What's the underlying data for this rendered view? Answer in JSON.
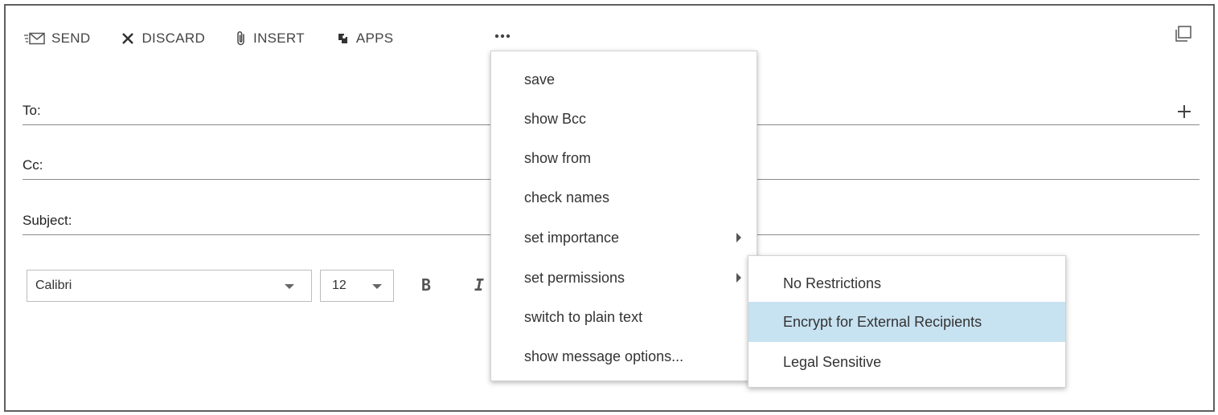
{
  "toolbar": {
    "send_label": "SEND",
    "discard_label": "DISCARD",
    "insert_label": "INSERT",
    "apps_label": "APPS",
    "more_label": "•••"
  },
  "fields": {
    "to_label": "To:",
    "cc_label": "Cc:",
    "subject_label": "Subject:",
    "to_value": "",
    "cc_value": "",
    "subject_value": ""
  },
  "formatting": {
    "font_name": "Calibri",
    "font_size": "12",
    "bold_label": "B",
    "italic_label": "I"
  },
  "menu": {
    "items": [
      {
        "label": "save"
      },
      {
        "label": "show Bcc"
      },
      {
        "label": "show from"
      },
      {
        "label": "check names"
      },
      {
        "label": "set importance"
      },
      {
        "label": "set permissions"
      },
      {
        "label": "switch to plain text"
      },
      {
        "label": "show message options..."
      }
    ]
  },
  "permissions_submenu": {
    "items": [
      {
        "label": "No Restrictions"
      },
      {
        "label": "Encrypt for External Recipients"
      },
      {
        "label": "Legal Sensitive"
      }
    ]
  },
  "colors": {
    "highlight": "#c7e2f1",
    "text": "#333333",
    "border": "#5f5f5f"
  },
  "icons": {
    "send": "envelope-send-icon",
    "discard": "x-icon",
    "insert": "paperclip-icon",
    "apps": "apps-icon",
    "more": "ellipsis-icon",
    "popout": "popout-window-icon",
    "add": "plus-icon",
    "submenu_arrow": "chevron-right-icon",
    "dropdown_caret": "caret-down-icon"
  }
}
